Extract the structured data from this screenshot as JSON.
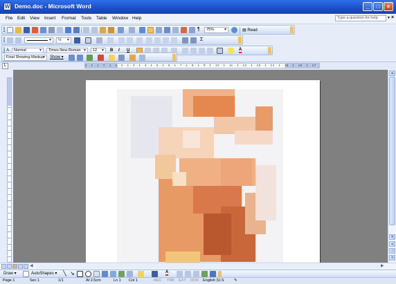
{
  "title": "Demo.doc - Microsoft Word",
  "app_icon_letter": "W",
  "window_controls": {
    "minimize": "_",
    "maximize": "□",
    "close": "×"
  },
  "menu": [
    "File",
    "Edit",
    "View",
    "Insert",
    "Format",
    "Tools",
    "Table",
    "Window",
    "Help"
  ],
  "help_box": {
    "placeholder": "Type a question for help"
  },
  "doc_close": "×",
  "standard_toolbar": {
    "zoom": "75%",
    "read_label": "Read"
  },
  "line_toolbar": {
    "weight": "½"
  },
  "formatting_toolbar": {
    "style": "Normal",
    "font": "Times New Roman",
    "size": "12",
    "bold": "B",
    "italic": "I",
    "underline": "U"
  },
  "reviewing_toolbar": {
    "markup": "Final Showing Markup",
    "show": "Show"
  },
  "ruler": {
    "tab_selector": "L",
    "ticks": "2 · 1 · 1 · ▽ · 1 · 1 · 2 · 1 · 3 · 1 · 4 · 1 · 5 · 1 · 6 · 1 · 7 · 1 · 8 · 1 · 9 · 1 · 10 · 1 · 11 · 1 · 12 · 1 · 13 · 1 · 14 · 1 · 15 · 1 · 16 · 1 · 17 · 1 · 18"
  },
  "draw_toolbar": {
    "draw": "Draw",
    "autoshapes": "AutoShapes"
  },
  "status": {
    "page": "Page 1",
    "sec": "Sec 1",
    "pages": "1/1",
    "at": "At 2.5cm",
    "ln": "Ln 1",
    "col": "Col 1",
    "rec": "REC",
    "trk": "TRK",
    "ext": "EXT",
    "ovr": "OVR",
    "language": "English (U.S"
  },
  "colors": {
    "title_bar": "#1b4fc9",
    "toolbar": "#cfdcf3",
    "doc_bg": "#808080",
    "accent_orange": "#e48a55"
  }
}
